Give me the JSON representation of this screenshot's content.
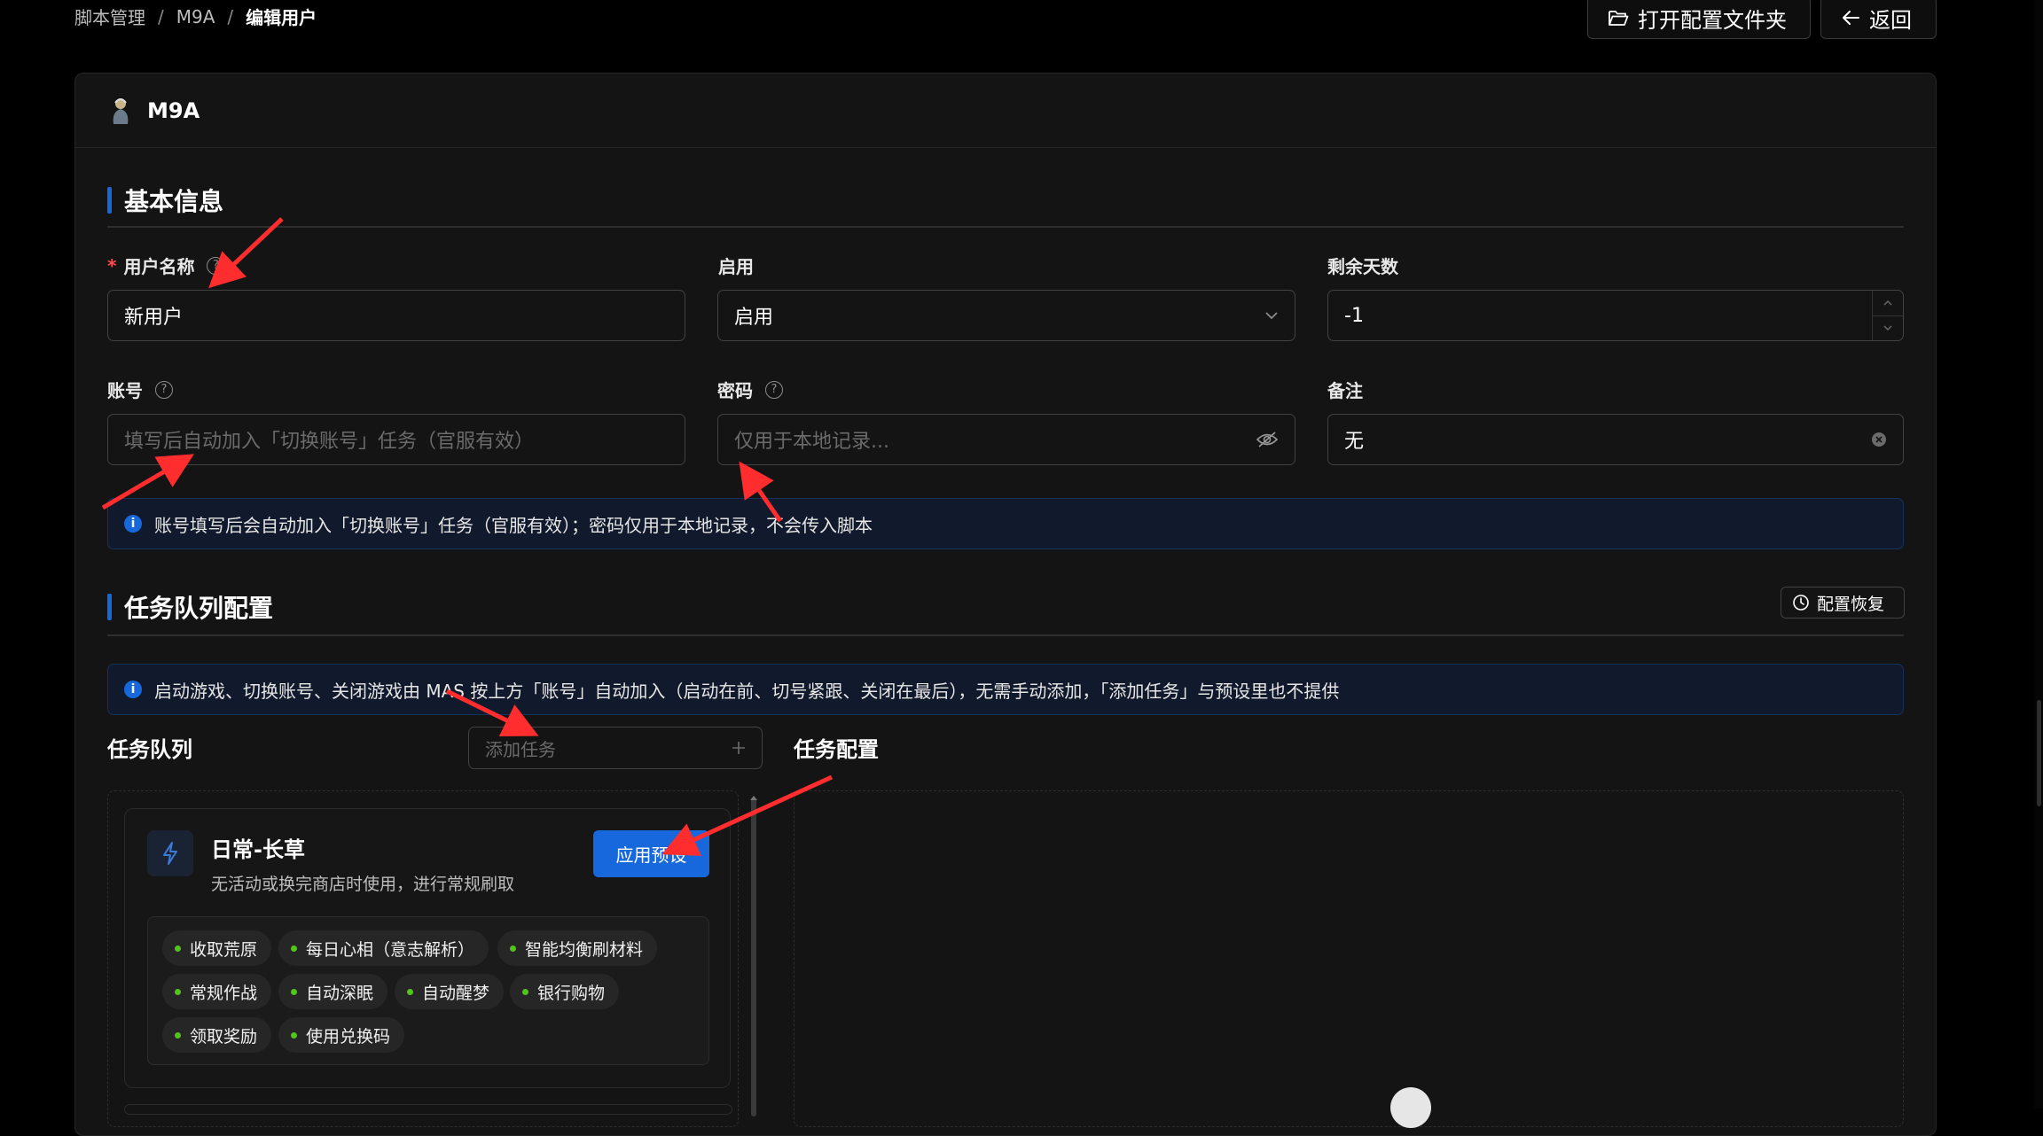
{
  "breadcrumb": [
    "脚本管理",
    "M9A",
    "编辑用户"
  ],
  "header": {
    "open_folder": "打开配置文件夹",
    "back": "返回"
  },
  "app": {
    "name": "M9A"
  },
  "basic": {
    "title": "基本信息",
    "username": {
      "label": "用户名称",
      "value": "新用户"
    },
    "enabled": {
      "label": "启用",
      "value": "启用"
    },
    "days": {
      "label": "剩余天数",
      "value": "-1"
    },
    "account": {
      "label": "账号",
      "placeholder": "填写后自动加入「切换账号」任务（官服有效）"
    },
    "password": {
      "label": "密码",
      "placeholder": "仅用于本地记录..."
    },
    "note": {
      "label": "备注",
      "value": "无"
    },
    "alert": "账号填写后会自动加入「切换账号」任务（官服有效）；密码仅用于本地记录，不会传入脚本"
  },
  "queue": {
    "title": "任务队列配置",
    "restore": "配置恢复",
    "alert": "启动游戏、切换账号、关闭游戏由 MAS 按上方「账号」自动加入（启动在前、切号紧跟、关闭在最后），无需手动添加，「添加任务」与预设里也不提供",
    "list_title": "任务队列",
    "add_task": "添加任务",
    "config_title": "任务配置",
    "preset": {
      "title": "日常-长草",
      "desc": "无活动或换完商店时使用，进行常规刷取",
      "apply": "应用预设",
      "tags": [
        "收取荒原",
        "每日心相（意志解析）",
        "智能均衡刷材料",
        "常规作战",
        "自动深眠",
        "自动醒梦",
        "银行购物",
        "领取奖励",
        "使用兑换码"
      ]
    }
  },
  "colors": {
    "accent": "#1668dc",
    "required": "#ff4d4f",
    "annotation": "#ff2d2d",
    "tag_dot": "#52c41a"
  }
}
